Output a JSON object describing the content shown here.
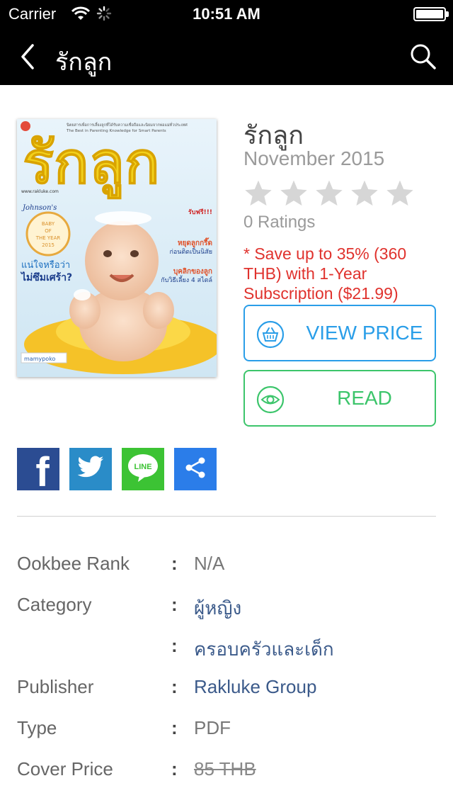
{
  "status_bar": {
    "carrier": "Carrier",
    "time": "10:51 AM"
  },
  "nav": {
    "title": "รักลูก",
    "back_icon": "chevron-left-icon",
    "search_icon": "search-icon"
  },
  "cover": {
    "masthead": "รักลูก",
    "tagline_1": "นิตยสารเพื่อการเลี้ยงลูกที่ได้รับความเชื่อถือและนิยมจากพ่อแม่ทั่วประเทศ",
    "tagline_2": "The Best in Parenting Knowledge for Smart Parents",
    "website": "www.rakluke.com",
    "sponsor": "Johnson's",
    "badge_line_1": "BABY",
    "badge_line_2": "OF",
    "badge_line_3": "THE YEAR",
    "badge_line_4": "2015",
    "headline_left_1": "แน่ใจหรือว่า",
    "headline_left_2": "ไม่ซึมเศร้า?",
    "headline_right_1": "รับฟรี!!!",
    "headline_right_2": "หยุดลูกกรี๊ด",
    "headline_right_3": "ก่อนติดเป็นนิสัย",
    "headline_right_4": "บุคลิกของลูก",
    "headline_right_5": "กับวิธีเลี้ยง 4 สไตล์",
    "bottom_logo": "mamypoko"
  },
  "product": {
    "title": "รักลูก",
    "issue": "November 2015",
    "rating_value": 0,
    "rating_max": 5,
    "ratings_text": "0 Ratings",
    "promo": "* Save up to 35% (360 THB) with 1-Year Subscription ($21.99)",
    "view_price_label": "VIEW PRICE",
    "read_label": "READ"
  },
  "share": {
    "facebook": "f",
    "line": "LINE"
  },
  "details": {
    "rank_key": "Ookbee Rank",
    "rank_value": "N/A",
    "category_key": "Category",
    "category_value_1": "ผู้หญิง",
    "category_value_2": "ครอบครัวและเด็ก",
    "publisher_key": "Publisher",
    "publisher_value": "Rakluke Group",
    "type_key": "Type",
    "type_value": "PDF",
    "cover_price_key": "Cover Price",
    "cover_price_value": "85 THB",
    "colon": ":"
  },
  "colors": {
    "blue": "#2a9ee8",
    "green": "#3cc56b",
    "promo_red": "#e0322d",
    "link": "#3b5a8a",
    "facebook": "#2b4c92",
    "twitter": "#2a8cc8",
    "line": "#3cc334",
    "share": "#2b7de9"
  }
}
